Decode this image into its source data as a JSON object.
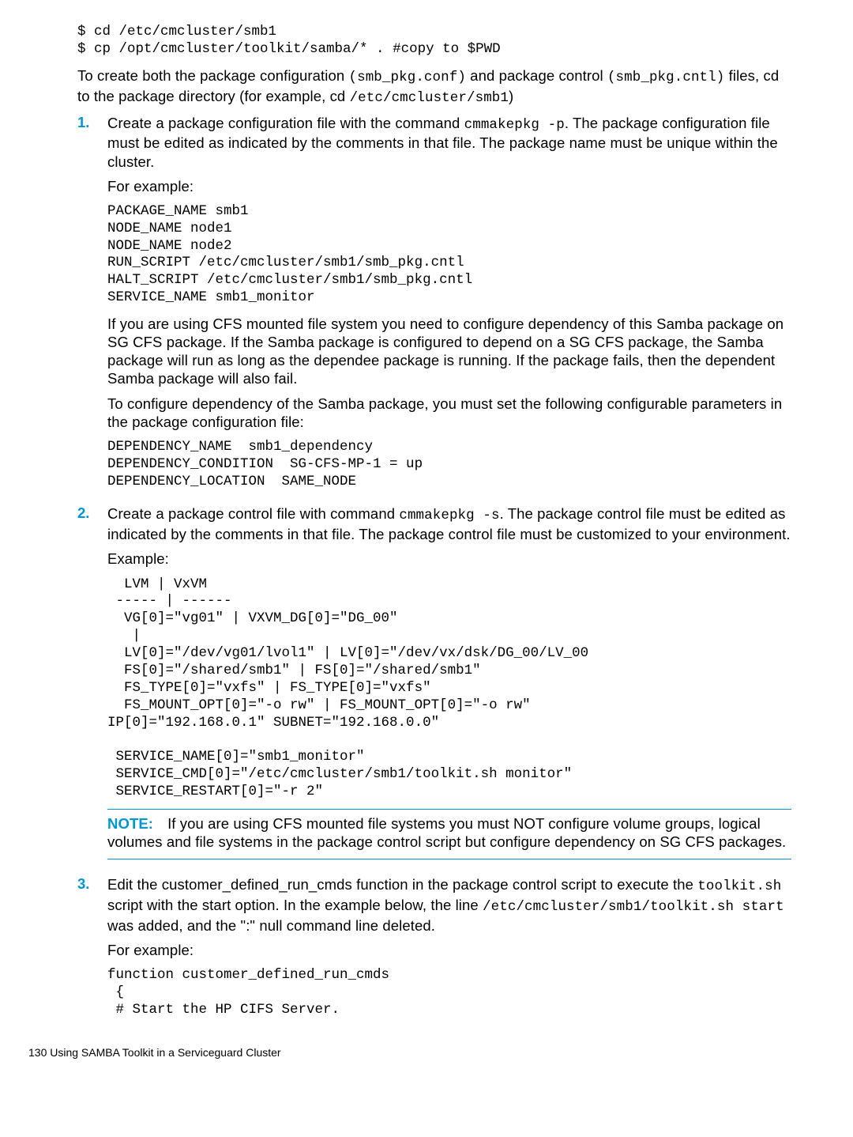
{
  "preamble": {
    "cmd1": "$ cd /etc/cmcluster/smb1",
    "cmd2": "$ cp /opt/cmcluster/toolkit/samba/* . #copy to $PWD",
    "para1_a": "To create both the package configuration ",
    "para1_b": "(smb_pkg.conf)",
    "para1_c": " and package control ",
    "para1_d": "(smb_pkg.cntl)",
    "para1_e": " files, cd to the package directory (for example, cd ",
    "para1_f": "/etc/cmcluster/smb1",
    "para1_g": ")"
  },
  "step1": {
    "num": "1.",
    "para1_a": "Create a package configuration file with the command ",
    "para1_b": "cmmakepkg -p",
    "para1_c": ". The package configuration file must be edited as indicated by the comments in that file. The package name must be unique within the cluster.",
    "for_example": "For example:",
    "code1": "PACKAGE_NAME smb1\nNODE_NAME node1\nNODE_NAME node2\nRUN_SCRIPT /etc/cmcluster/smb1/smb_pkg.cntl\nHALT_SCRIPT /etc/cmcluster/smb1/smb_pkg.cntl\nSERVICE_NAME smb1_monitor",
    "para2": "If you are using CFS mounted file system you need to configure dependency of this Samba package on SG CFS package. If the Samba package is configured to depend on a SG CFS package, the Samba package will run as long as the dependee package is running. If the package fails, then the dependent Samba package will also fail.",
    "para3": "To configure dependency of the Samba package, you must set the following configurable parameters in the package configuration file:",
    "code2": "DEPENDENCY_NAME  smb1_dependency\nDEPENDENCY_CONDITION  SG-CFS-MP-1 = up\nDEPENDENCY_LOCATION  SAME_NODE"
  },
  "step2": {
    "num": "2.",
    "para1_a": "Create a package control file with command ",
    "para1_b": "cmmakepkg -s",
    "para1_c": ". The package control file must be edited as indicated by the comments in that file. The package control file must be customized to your environment.",
    "example": "Example:",
    "code1": "  LVM | VxVM\n ----- | ------\n  VG[0]=\"vg01\" | VXVM_DG[0]=\"DG_00\"\n   |\n  LV[0]=\"/dev/vg01/lvol1\" | LV[0]=\"/dev/vx/dsk/DG_00/LV_00\n  FS[0]=\"/shared/smb1\" | FS[0]=\"/shared/smb1\"\n  FS_TYPE[0]=\"vxfs\" | FS_TYPE[0]=\"vxfs\"\n  FS_MOUNT_OPT[0]=\"-o rw\" | FS_MOUNT_OPT[0]=\"-o rw\"\nIP[0]=\"192.168.0.1\" SUBNET=\"192.168.0.0\"\n\n SERVICE_NAME[0]=\"smb1_monitor\"\n SERVICE_CMD[0]=\"/etc/cmcluster/smb1/toolkit.sh monitor\"\n SERVICE_RESTART[0]=\"-r 2\"",
    "note_label": "NOTE:",
    "note_text": "If you are using CFS mounted file systems you must NOT configure volume groups, logical volumes and file systems in the package control script but configure dependency on SG CFS packages."
  },
  "step3": {
    "num": "3.",
    "para1_a": "Edit the customer_defined_run_cmds function in the package control script to execute the ",
    "para1_b": "toolkit.sh",
    "para1_c": " script with the start option. In the example below, the line ",
    "para1_d": "/etc/cmcluster/smb1/toolkit.sh start",
    "para1_e": " was added, and the \":\" null command line deleted.",
    "for_example": "For example:",
    "code1": "function customer_defined_run_cmds\n {\n # Start the HP CIFS Server."
  },
  "footer": "130   Using SAMBA Toolkit in a Serviceguard Cluster"
}
